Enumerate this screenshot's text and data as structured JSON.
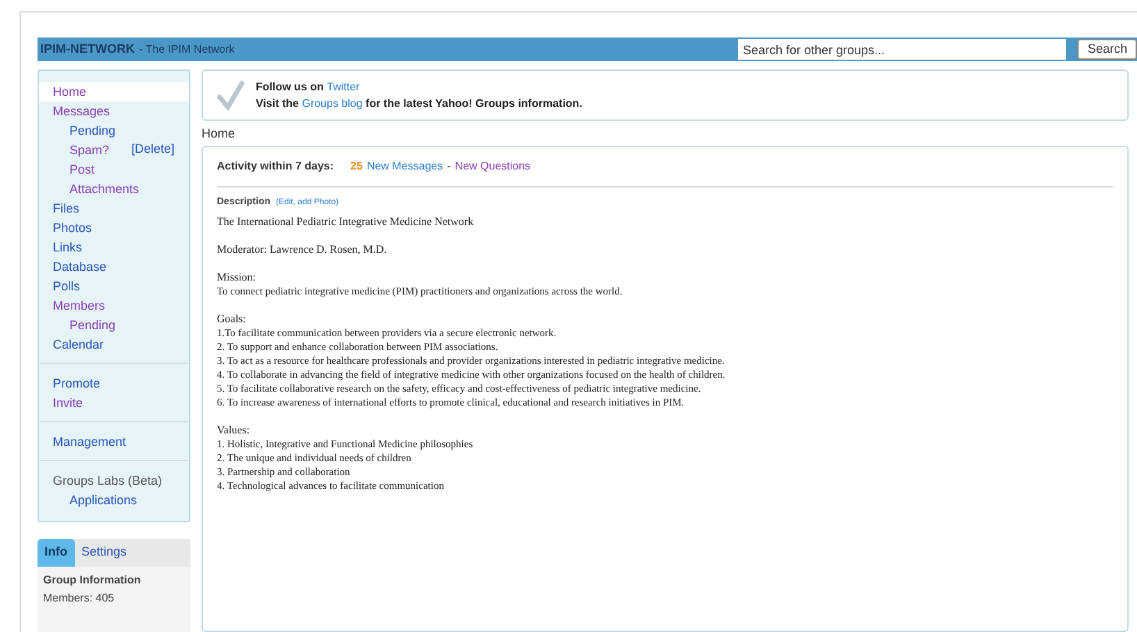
{
  "header": {
    "group_name": "IPIM-NETWORK",
    "tagline": "- The IPIM Network",
    "search": {
      "placeholder": "Search for other groups..."
    },
    "search_button": "Search"
  },
  "sidebar": {
    "sections": [
      [
        {
          "label": "Home",
          "visited": true,
          "selected": true
        },
        {
          "label": "Messages",
          "visited": true,
          "selected": false,
          "children": [
            {
              "label": "Pending",
              "visited": false,
              "selected": false
            },
            {
              "label": "Spam?",
              "visited": true,
              "selected": false,
              "action": "[Delete]"
            },
            {
              "label": "Post",
              "visited": true,
              "selected": false
            },
            {
              "label": "Attachments",
              "visited": true,
              "selected": false
            }
          ]
        },
        {
          "label": "Files",
          "visited": false,
          "selected": false
        },
        {
          "label": "Photos",
          "visited": false,
          "selected": false
        },
        {
          "label": "Links",
          "visited": false,
          "selected": false
        },
        {
          "label": "Database",
          "visited": false,
          "selected": false
        },
        {
          "label": "Polls",
          "visited": false,
          "selected": false
        },
        {
          "label": "Members",
          "visited": true,
          "selected": false,
          "children": [
            {
              "label": "Pending",
              "visited": true,
              "selected": false
            }
          ]
        },
        {
          "label": "Calendar",
          "visited": false,
          "selected": false
        }
      ],
      [
        {
          "label": "Promote",
          "visited": false,
          "selected": false
        },
        {
          "label": "Invite",
          "visited": true,
          "selected": false
        }
      ],
      [
        {
          "label": "Management",
          "visited": false,
          "selected": false
        }
      ],
      [
        {
          "label": "Groups Labs (Beta)",
          "kind": "heading",
          "children": [
            {
              "label": "Applications",
              "visited": false,
              "selected": false
            }
          ]
        }
      ]
    ]
  },
  "info_tabs": [
    {
      "label": "Info",
      "selected": true
    },
    {
      "label": "Settings",
      "selected": false
    }
  ],
  "info": {
    "title": "Group Information",
    "members": "Members: 405"
  },
  "banner": {
    "line1": "Follow us on",
    "link1": "Twitter",
    "line2_before": "Visit the",
    "link2": "Groups blog",
    "line2_after": "for the latest Yahoo! Groups information."
  },
  "breadcrumb": "Home",
  "activity": {
    "label": "Activity within 7 days:",
    "count": "25",
    "messages": "New Messages",
    "separator": "-",
    "questions": "New Questions"
  },
  "description": {
    "label": "Description",
    "edit_link": "(Edit, add Photo)",
    "blocks": [
      {
        "title": "The International Pediatric Integrative Medicine Network"
      },
      {
        "title": "Moderator: Lawrence D. Rosen, M.D."
      },
      {
        "title": "Mission:",
        "lines": [
          "To connect pediatric integrative medicine (PIM) practitioners and organizations across the world."
        ]
      },
      {
        "title": "Goals:",
        "lines": [
          "1.To facilitate communication between providers via a secure electronic network.",
          "2. To support and enhance collaboration between PIM associations.",
          "3. To act as a resource for healthcare professionals and provider organizations interested in pediatric integrative medicine.",
          "4. To collaborate in advancing the field of integrative medicine with other organizations focused on the health of children.",
          "5. To facilitate collaborative research on the safety, efficacy and cost-effectiveness of pediatric integrative medicine.",
          "6. To increase awareness of international efforts to promote clinical, educational and research initiatives in PIM."
        ]
      },
      {
        "title": "Values:",
        "lines": [
          "1. Holistic, Integrative and Functional Medicine philosophies",
          "2. The unique and individual needs of children",
          "3. Partnership and collaboration",
          "4. Technological advances to facilitate communication"
        ]
      }
    ]
  }
}
